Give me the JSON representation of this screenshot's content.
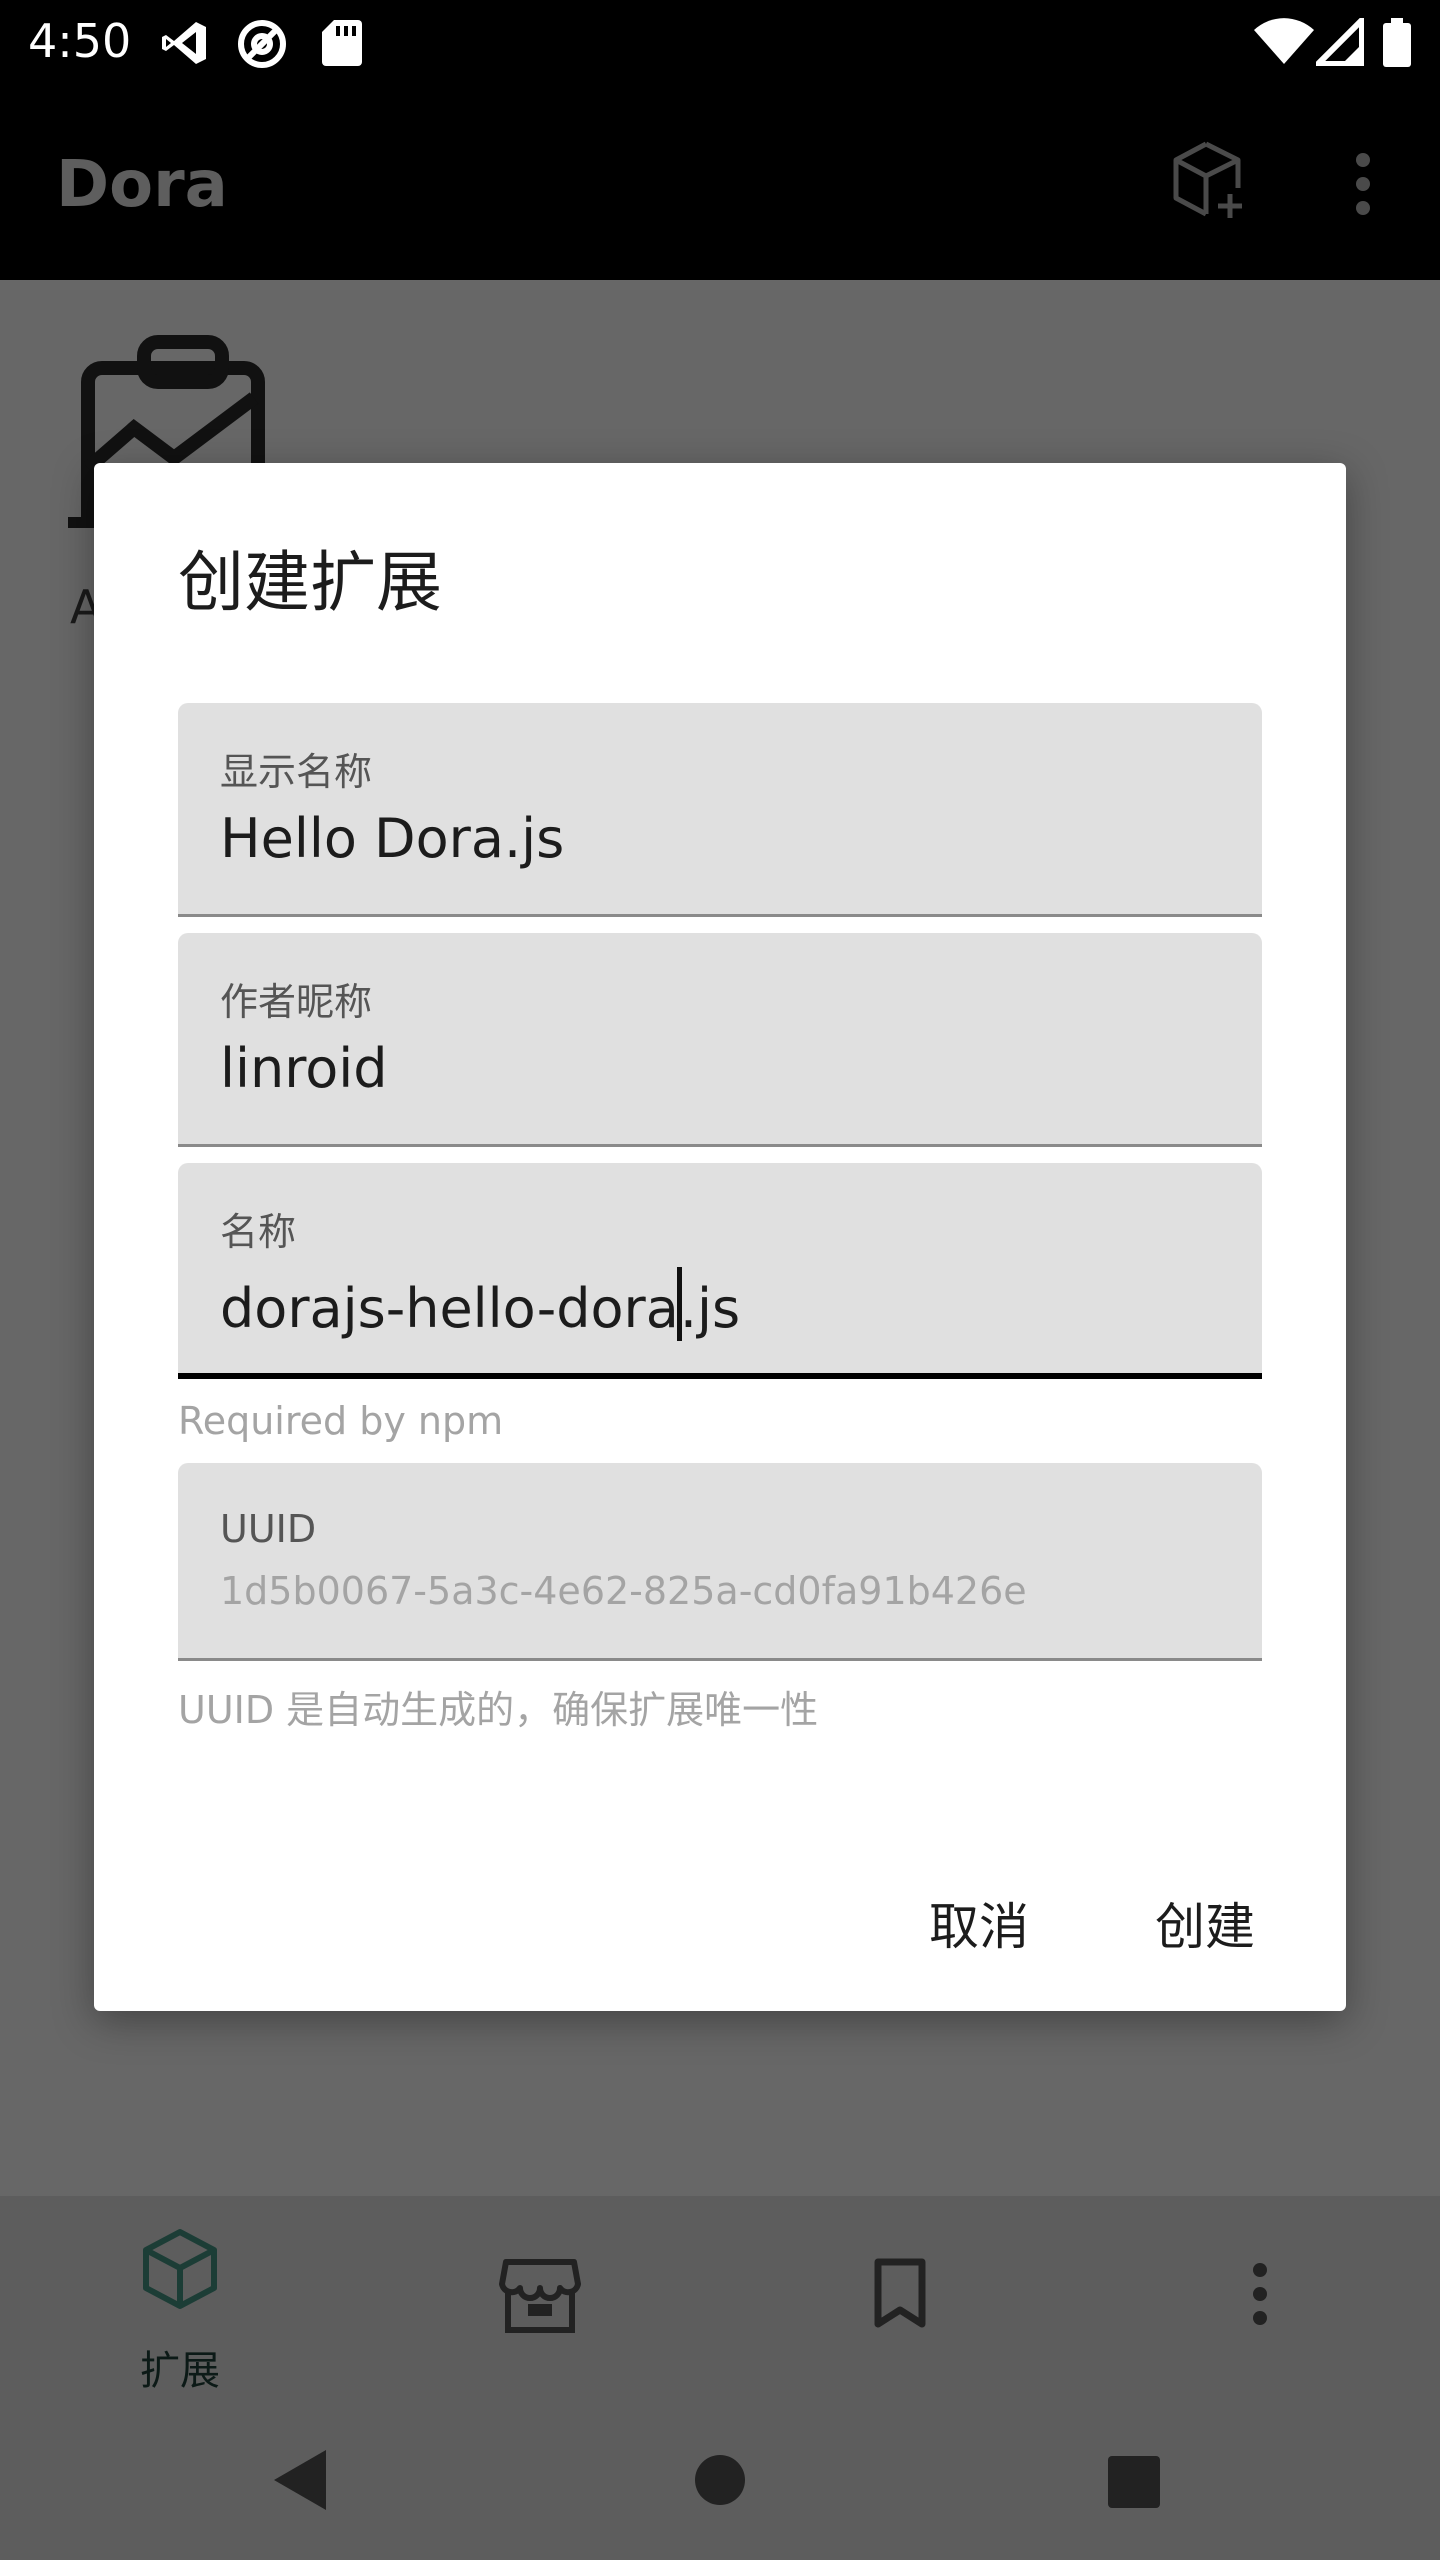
{
  "status_bar": {
    "time": "4:50",
    "left_icons": [
      "vscode-icon",
      "at-sign-icon",
      "sd-card-icon"
    ],
    "right_icons": [
      "wifi-icon",
      "signal-icon",
      "battery-icon"
    ]
  },
  "app_bar": {
    "title": "Dora",
    "actions": [
      "add-extension-icon",
      "more-vert-icon"
    ]
  },
  "background": {
    "partial_letter": "A"
  },
  "dialog": {
    "title": "创建扩展",
    "fields": {
      "display_name": {
        "label": "显示名称",
        "value": "Hello Dora.js"
      },
      "author": {
        "label": "作者昵称",
        "value": "linroid"
      },
      "name": {
        "label": "名称",
        "value_before_cursor": "dorajs-hello-dora",
        "value_after_cursor": ".js",
        "helper": "Required by npm"
      },
      "uuid": {
        "label": "UUID",
        "value": "1d5b0067-5a3c-4e62-825a-cd0fa91b426e",
        "helper": "UUID 是自动生成的，确保扩展唯一性"
      }
    },
    "buttons": {
      "cancel": "取消",
      "create": "创建"
    }
  },
  "bottom_nav": {
    "items": [
      {
        "label": "扩展",
        "icon": "cube-icon",
        "active": true
      },
      {
        "label": "",
        "icon": "store-icon",
        "active": false
      },
      {
        "label": "",
        "icon": "bookmark-icon",
        "active": false
      },
      {
        "label": "",
        "icon": "more-vert-icon",
        "active": false
      }
    ]
  },
  "colors": {
    "accent": "#1c3d36",
    "dialog_bg": "#ffffff",
    "field_bg": "#e0e0e0",
    "scrim": "#666666"
  }
}
